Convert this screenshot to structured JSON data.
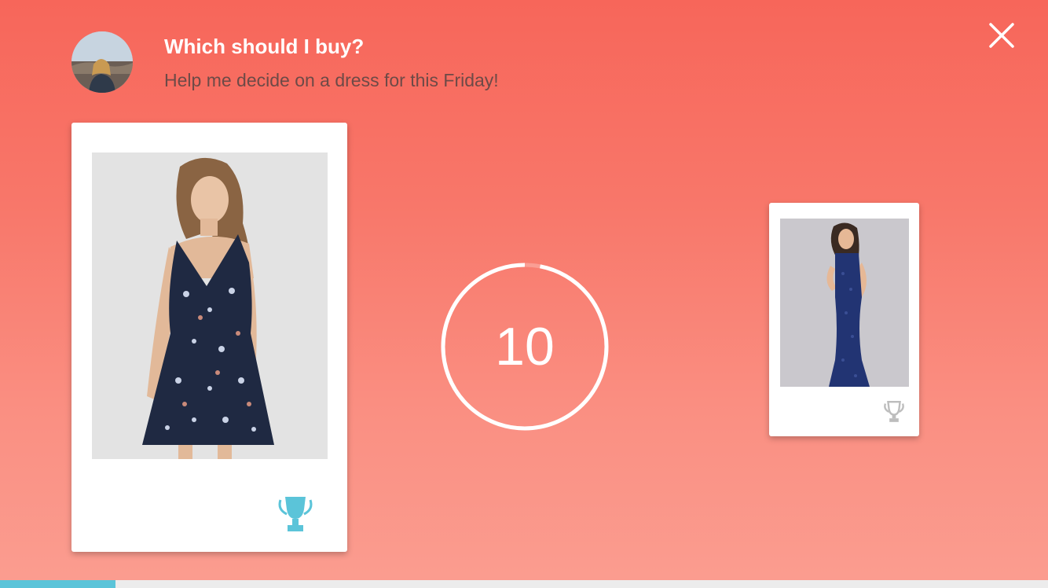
{
  "header": {
    "title": "Which should I buy?",
    "subtitle": "Help me decide on a dress for this Friday!"
  },
  "timer": {
    "value": "10",
    "remaining_fraction": 0.97
  },
  "options": [
    {
      "image": "floral-navy-sundress",
      "selected": true
    },
    {
      "image": "navy-lace-gown",
      "selected": false
    }
  ],
  "progress": {
    "fraction": 0.11
  },
  "colors": {
    "accent": "#5bc4d9",
    "trophy_inactive": "#bdbdbd",
    "background_top": "#f7665a",
    "background_bottom": "#fb9d90"
  },
  "icons": {
    "close": "close-icon",
    "trophy": "trophy-icon"
  }
}
